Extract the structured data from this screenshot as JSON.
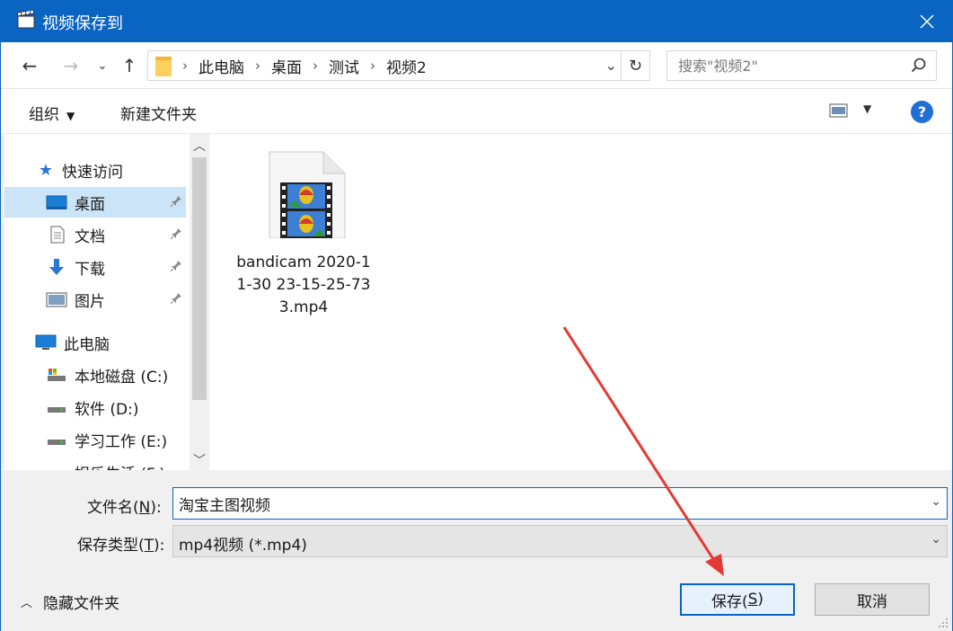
{
  "window": {
    "title": "视频保存到"
  },
  "address": {
    "crumbs": [
      "此电脑",
      "桌面",
      "测试",
      "视频2"
    ],
    "search_placeholder": "搜索\"视频2\""
  },
  "toolbar": {
    "organize": "组织",
    "new_folder": "新建文件夹"
  },
  "nav": {
    "quick_access": "快速访问",
    "items": [
      "桌面",
      "文档",
      "下载",
      "图片"
    ],
    "this_pc": "此电脑",
    "drives": [
      "本地磁盘 (C:)",
      "软件 (D:)",
      "学习工作 (E:)",
      "娱乐生活 (F:)"
    ]
  },
  "files": [
    {
      "name": "bandicam 2020-11-30 23-15-25-733.mp4",
      "icon": "video-file-icon"
    }
  ],
  "form": {
    "filename_label_pre": "文件名(",
    "filename_label_key": "N",
    "filename_label_post": "):",
    "filename_value": "淘宝主图视频",
    "filetype_label_pre": "保存类型(",
    "filetype_label_key": "T",
    "filetype_label_post": "):",
    "filetype_value": "mp4视频 (*.mp4)"
  },
  "footer": {
    "hide_folders": "隐藏文件夹",
    "save_pre": "保存(",
    "save_key": "S",
    "save_post": ")",
    "cancel": "取消"
  },
  "colors": {
    "titlebar": "#0a64c2",
    "selection": "#cce4f7",
    "annotation": "#e53935"
  }
}
